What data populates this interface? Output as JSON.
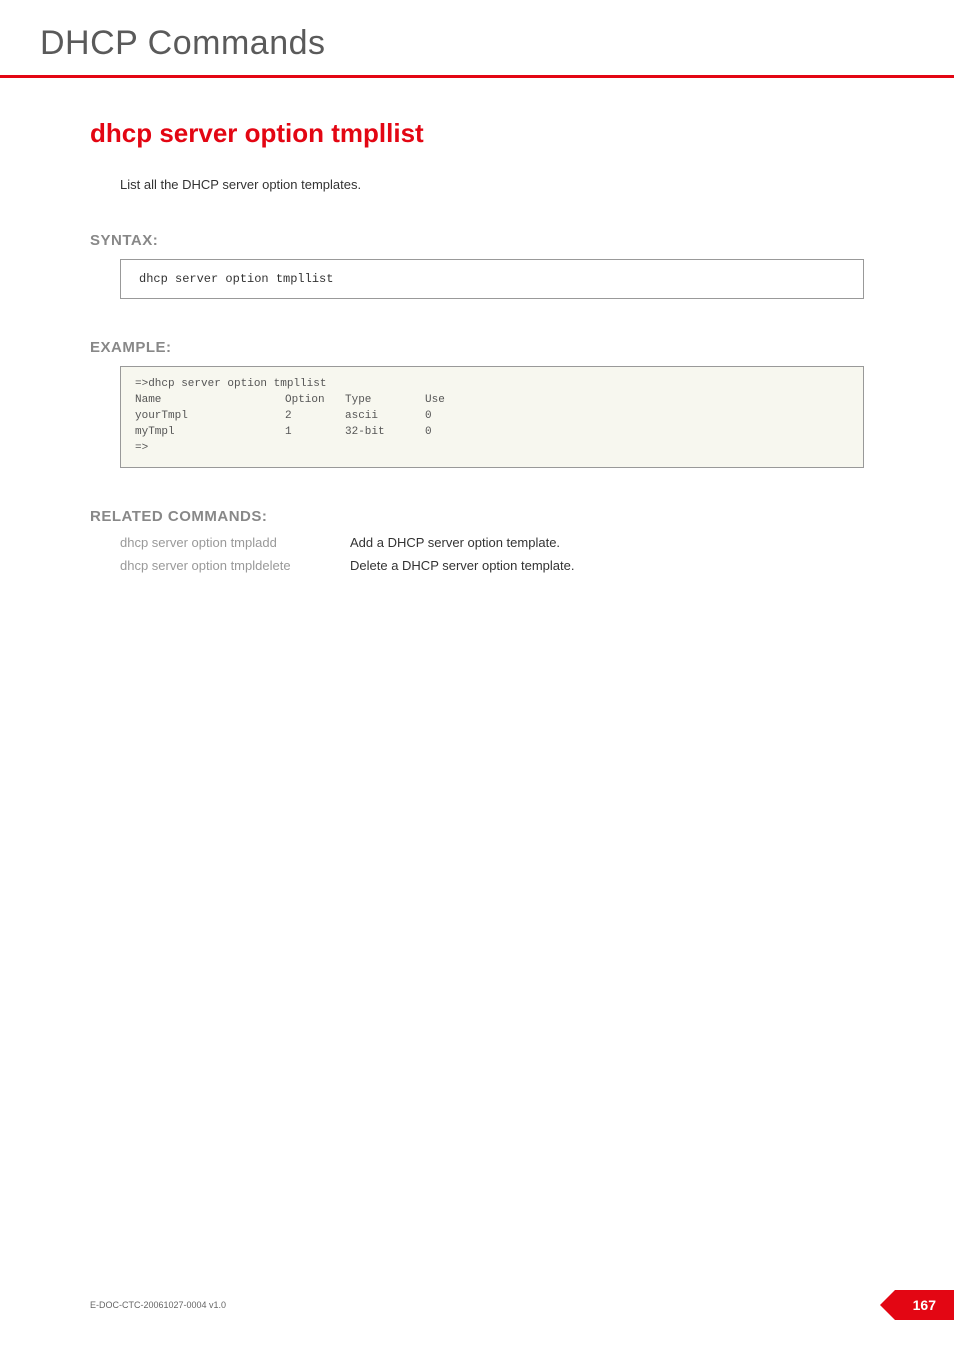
{
  "header": {
    "title": "DHCP Commands"
  },
  "command": {
    "title": "dhcp server option tmpllist",
    "description": "List all the DHCP server option templates."
  },
  "syntax": {
    "heading": "SYNTAX:",
    "text": "dhcp server option tmpllist"
  },
  "example": {
    "heading": "EXAMPLE:",
    "command_line": "=>dhcp server option tmpllist",
    "headers": {
      "name": "Name",
      "option": "Option",
      "type": "Type",
      "use": "Use"
    },
    "rows": [
      {
        "name": "yourTmpl",
        "option": "2",
        "type": "ascii",
        "use": "0"
      },
      {
        "name": "myTmpl",
        "option": "1",
        "type": "32-bit",
        "use": "0"
      }
    ],
    "prompt": "=>"
  },
  "related": {
    "heading": "RELATED COMMANDS:",
    "items": [
      {
        "cmd": "dhcp server option tmpladd",
        "desc": "Add a DHCP server option template."
      },
      {
        "cmd": "dhcp server option tmpldelete",
        "desc": "Delete a DHCP server option template."
      }
    ]
  },
  "footer": {
    "doc_id": "E-DOC-CTC-20061027-0004 v1.0",
    "page_number": "167"
  }
}
